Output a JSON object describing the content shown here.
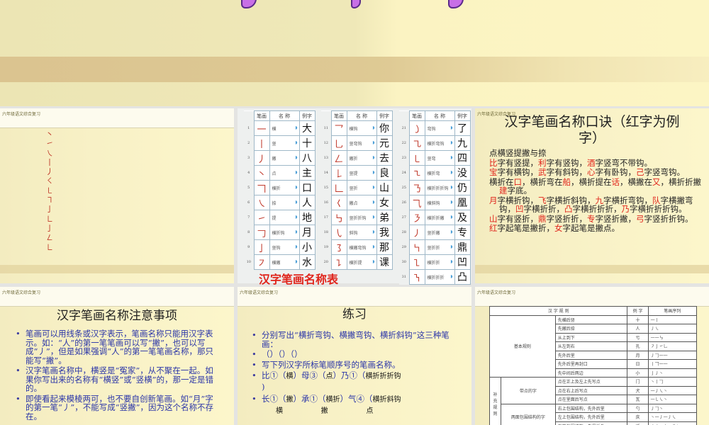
{
  "header_label": "六年级语文综合复习",
  "panel1": {
    "strokes": [
      "丶",
      "㇀",
      "㇏",
      "丨",
      "丿",
      "㇛",
      "㇄",
      "㇕",
      "亅",
      "㇗",
      "亅",
      "㇜",
      "㇗"
    ]
  },
  "stroke_table": {
    "headers": [
      "笔画",
      "名 称",
      "例字"
    ],
    "title": "汉字笔画名称表",
    "link_icon": "speaker-icon",
    "rows": [
      {
        "n": "1",
        "g": "一",
        "name": "横",
        "c": "大"
      },
      {
        "n": "2",
        "g": "丨",
        "name": "竖",
        "c": "十"
      },
      {
        "n": "3",
        "g": "丿",
        "name": "撇",
        "c": "八"
      },
      {
        "n": "4",
        "g": "丶",
        "name": "点",
        "c": "主"
      },
      {
        "n": "5",
        "g": "𠃍",
        "name": "横折",
        "c": "口"
      },
      {
        "n": "6",
        "g": "㇏",
        "name": "捺",
        "c": "人"
      },
      {
        "n": "7",
        "g": "㇀",
        "name": "提",
        "c": "地"
      },
      {
        "n": "8",
        "g": "𠃌",
        "name": "横折钩",
        "c": "月"
      },
      {
        "n": "9",
        "g": "亅",
        "name": "竖钩",
        "c": "小"
      },
      {
        "n": "10",
        "g": "㇇",
        "name": "横撇",
        "c": "水"
      },
      {
        "n": "11",
        "g": "乛",
        "name": "横钩",
        "c": "你"
      },
      {
        "n": "12",
        "g": "乚",
        "name": "竖弯钩",
        "c": "元"
      },
      {
        "n": "13",
        "g": "𠃋",
        "name": "撇折",
        "c": "去"
      },
      {
        "n": "14",
        "g": "𠄌",
        "name": "竖提",
        "c": "良"
      },
      {
        "n": "15",
        "g": "𠃊",
        "name": "竖折",
        "c": "山"
      },
      {
        "n": "16",
        "g": "𡿨",
        "name": "撇点",
        "c": "女"
      },
      {
        "n": "17",
        "g": "㇉",
        "name": "竖折折钩",
        "c": "弟"
      },
      {
        "n": "18",
        "g": "㇂",
        "name": "斜钩",
        "c": "我"
      },
      {
        "n": "19",
        "g": "㇌",
        "name": "横撇弯钩",
        "c": "那"
      },
      {
        "n": "20",
        "g": "㇊",
        "name": "横折提",
        "c": "课"
      },
      {
        "n": "21",
        "g": "㇁",
        "name": "弯钩",
        "c": "了"
      },
      {
        "n": "22",
        "g": "㇈",
        "name": "横折弯钩",
        "c": "九"
      },
      {
        "n": "23",
        "g": "㇄",
        "name": "竖弯",
        "c": "四"
      },
      {
        "n": "24",
        "g": "㇍",
        "name": "横折弯",
        "c": "没"
      },
      {
        "n": "25",
        "g": "㇡",
        "name": "横折折折钩",
        "c": "仍"
      },
      {
        "n": "26",
        "g": "⺄",
        "name": "横斜钩",
        "c": "凰"
      },
      {
        "n": "27",
        "g": "㇋",
        "name": "横折折撇",
        "c": "及"
      },
      {
        "n": "28",
        "g": "㇓",
        "name": "竖折撇",
        "c": "专"
      },
      {
        "n": "29",
        "g": "㇞",
        "name": "竖折折",
        "c": "鼎"
      },
      {
        "n": "30",
        "g": "㇅",
        "name": "横折折",
        "c": "凹"
      },
      {
        "n": "31",
        "g": "㇎",
        "name": "横折折折",
        "c": "凸"
      }
    ]
  },
  "mnemonic": {
    "title": "汉字笔画名称口诀（红字为例字）",
    "lines": [
      [
        {
          "t": "点横竖提撇与捺"
        }
      ],
      [
        {
          "t": "比",
          "r": 1
        },
        {
          "t": "字有竖提，"
        },
        {
          "t": "利",
          "r": 1
        },
        {
          "t": "字有竖钩，"
        },
        {
          "t": "酒",
          "r": 1
        },
        {
          "t": "字竖弯不带钩。"
        }
      ],
      [
        {
          "t": "宝",
          "r": 1
        },
        {
          "t": "字有横钩，"
        },
        {
          "t": "武",
          "r": 1
        },
        {
          "t": "字有斜钩，"
        },
        {
          "t": "心",
          "r": 1
        },
        {
          "t": "字有卧钩，"
        },
        {
          "t": "己",
          "r": 1
        },
        {
          "t": "字竖弯钩。"
        }
      ],
      [
        {
          "t": "横折在"
        },
        {
          "t": "口",
          "r": 1
        },
        {
          "t": "，横折弯在"
        },
        {
          "t": "船",
          "r": 1
        },
        {
          "t": "，横折提在"
        },
        {
          "t": "话",
          "r": 1
        },
        {
          "t": "，横撇在"
        },
        {
          "t": "又",
          "r": 1
        },
        {
          "t": "，横折折撇"
        },
        {
          "t": "建",
          "r": 1
        },
        {
          "t": "字底。"
        }
      ],
      [
        {
          "t": "月",
          "r": 1
        },
        {
          "t": "字横折钩，"
        },
        {
          "t": "飞",
          "r": 1
        },
        {
          "t": "字横折斜钩，"
        },
        {
          "t": "九",
          "r": 1
        },
        {
          "t": "字横折弯钩，"
        },
        {
          "t": "队",
          "r": 1
        },
        {
          "t": "字横撇弯钩，"
        },
        {
          "t": "凹",
          "r": 1
        },
        {
          "t": "字横折折，"
        },
        {
          "t": "凸",
          "r": 1
        },
        {
          "t": "字横折折折，"
        },
        {
          "t": "乃",
          "r": 1
        },
        {
          "t": "字横折折折钩。"
        }
      ],
      [
        {
          "t": "山",
          "r": 1
        },
        {
          "t": "字有竖折，"
        },
        {
          "t": "鼎",
          "r": 1
        },
        {
          "t": "字竖折折，"
        },
        {
          "t": "专",
          "r": 1
        },
        {
          "t": "字竖折撇，"
        },
        {
          "t": "弓",
          "r": 1
        },
        {
          "t": "字竖折折钩。"
        }
      ],
      [
        {
          "t": "红",
          "r": 1
        },
        {
          "t": "字起笔是撇折，"
        },
        {
          "t": "女",
          "r": 1
        },
        {
          "t": "字起笔是撇点。"
        }
      ]
    ]
  },
  "notes": {
    "title": "汉字笔画名称注意事项",
    "items": [
      "笔画可以用线条或汉字表示，笔画名称只能用汉字表示。如：“人”的第一笔笔画可以写“撇”，也可以写成“丿”，但是如果强调“人”的第一笔笔画名称，那只能写“撇”。",
      "汉字笔画名称中，横竖是“冤家”，从不聚在一起。如果你写出来的名称有“横竖”或“竖横”的，那一定是错的。",
      "即使看起来模棱两可，也不要自创新笔画。如“月”字的第一笔“丿”，不能写成“竖撇”，因为这个名称不存在。"
    ]
  },
  "exercise": {
    "title": "练习",
    "items": [
      "分别写出“横折弯钩、横撇弯钩、横折斜钩”这三种笔画：",
      "（）（）（）",
      "写下列汉字所标笔顺序号的笔画名称。"
    ],
    "q1": [
      "比①（",
      "）母③（",
      "）乃①（",
      ")"
    ],
    "q1_answers": [
      "横",
      "点",
      "横折折折钩"
    ],
    "q2": [
      "长①（",
      "）承①（",
      "）气④（"
    ],
    "q2_answers": [
      "撇",
      "横折",
      "横折斜钩"
    ],
    "q3_answers": [
      "横",
      "撇",
      "点"
    ]
  },
  "rules": {
    "headers": [
      "汉 字 规 则",
      "例 字",
      "笔画序列"
    ],
    "basic": "基本规则",
    "supplement": "补充规则",
    "dot_group": "带点的字",
    "two_side_group": "两面包围结构的字",
    "basic_rows": [
      [
        "先横后竖",
        "十",
        "一丨"
      ],
      [
        "先撇后捺",
        "人",
        "丿㇏"
      ],
      [
        "从上到下",
        "亏",
        "一一㇉"
      ],
      [
        "从左到右",
        "孔",
        "㇇亅㇀乚"
      ],
      [
        "先外后里",
        "月",
        "丿𠃌一一"
      ],
      [
        "先外后里再封口",
        "日",
        "丨𠃍一一"
      ],
      [
        "先中间后两边",
        "小",
        "亅丿丶"
      ]
    ],
    "dot_rows": [
      [
        "点在正上及左上先写点",
        "门",
        "丶丨𠃌"
      ],
      [
        "点在右上后写点",
        "犬",
        "一丿㇏丶"
      ],
      [
        "点在里面后写点",
        "瓦",
        "一㇄㇏丶"
      ]
    ],
    "two_rows": [
      [
        "右上包围结构，先外后里",
        "勺",
        "丿𠃌丶"
      ],
      [
        "左上包围结构，先外后里",
        "庆",
        "丶一丿一丿㇏"
      ],
      [
        "左下包围结构，先里后外",
        "近",
        "丿丿一丨丶㇇㇏"
      ]
    ]
  }
}
